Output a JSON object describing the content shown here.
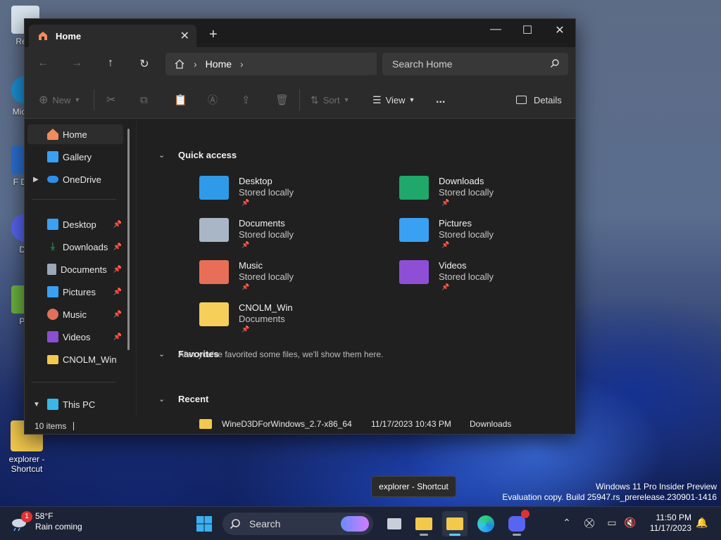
{
  "desktop": {
    "icons": [
      {
        "label": "Recy",
        "color": "#d9e4ee"
      },
      {
        "label": "Mic Ed",
        "color": "#1b8fd6"
      },
      {
        "label": "F Dow",
        "color": "#2a6fd0"
      },
      {
        "label": "Dis",
        "color": "#5865f2"
      },
      {
        "label": "Pol",
        "color": "#6cb33f"
      },
      {
        "label": "explorer - Shortcut",
        "color": "#f2c94c"
      }
    ],
    "tooltip": "explorer - Shortcut",
    "watermark_line1": "Windows 11 Pro Insider Preview",
    "watermark_line2": "Evaluation copy. Build 25947.rs_prerelease.230901-1416"
  },
  "window": {
    "tab_title": "Home",
    "breadcrumb": "Home",
    "search_placeholder": "Search Home",
    "toolbar": {
      "new_label": "New",
      "sort_label": "Sort",
      "view_label": "View",
      "more_label": "...",
      "details_label": "Details"
    },
    "nav": {
      "top": [
        {
          "label": "Home",
          "color": "#f28b5b"
        },
        {
          "label": "Gallery",
          "color": "#3aa0f2"
        },
        {
          "label": "OneDrive",
          "color": "#2e8fe8"
        }
      ],
      "pinned": [
        {
          "label": "Desktop",
          "color": "#3aa0f2"
        },
        {
          "label": "Downloads",
          "color": "#2cb56f"
        },
        {
          "label": "Documents",
          "color": "#9aa8b8"
        },
        {
          "label": "Pictures",
          "color": "#3aa0f2"
        },
        {
          "label": "Music",
          "color": "#e0705b"
        },
        {
          "label": "Videos",
          "color": "#8a4fd0"
        },
        {
          "label": "CNOLM_Win",
          "color": "#f2c94c"
        }
      ],
      "this_pc": "This PC"
    },
    "sections": {
      "quick_access": "Quick access",
      "favorites": "Favorites",
      "favorites_empty": "After you've favorited some files, we'll show them here.",
      "recent": "Recent"
    },
    "quick_access": [
      {
        "name": "Desktop",
        "sub": "Stored locally",
        "color": "#2f9be8"
      },
      {
        "name": "Downloads",
        "sub": "Stored locally",
        "color": "#1fa86a"
      },
      {
        "name": "Documents",
        "sub": "Stored locally",
        "color": "#a9b6c6"
      },
      {
        "name": "Pictures",
        "sub": "Stored locally",
        "color": "#3aa0f2"
      },
      {
        "name": "Music",
        "sub": "Stored locally",
        "color": "#e86f57"
      },
      {
        "name": "Videos",
        "sub": "Stored locally",
        "color": "#8e4fd6"
      },
      {
        "name": "CNOLM_Win",
        "sub": "Documents",
        "color": "#f5cf5a"
      }
    ],
    "recent": [
      {
        "name": "WineD3DForWindows_2.7-x86_64",
        "date": "11/17/2023 10:43 PM",
        "location": "Downloads"
      }
    ],
    "status": "10 items"
  },
  "taskbar": {
    "weather_temp": "58°F",
    "weather_desc": "Rain coming",
    "weather_badge": "1",
    "search_label": "Search",
    "time": "11:50 PM",
    "date": "11/17/2023"
  }
}
